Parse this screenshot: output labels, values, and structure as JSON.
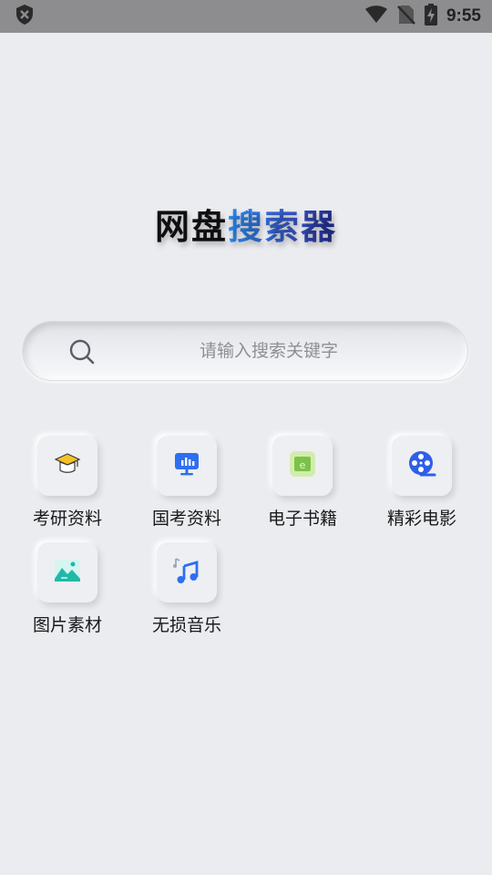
{
  "status_bar": {
    "time": "9:55",
    "icons": [
      "shield-icon",
      "wifi-icon",
      "no-sim-icon",
      "battery-charging-icon"
    ]
  },
  "app": {
    "title_part1": "网盘",
    "title_part2": "搜索器"
  },
  "search": {
    "placeholder": "请输入搜索关键字",
    "value": ""
  },
  "categories": [
    {
      "label": "考研资料",
      "icon": "graduation-cap-icon"
    },
    {
      "label": "国考资料",
      "icon": "presentation-board-icon"
    },
    {
      "label": "电子书籍",
      "icon": "ebook-icon"
    },
    {
      "label": "精彩电影",
      "icon": "film-reel-icon"
    },
    {
      "label": "图片素材",
      "icon": "image-icon"
    },
    {
      "label": "无损音乐",
      "icon": "music-note-icon"
    }
  ],
  "colors": {
    "background": "#ebecf0",
    "status_bar": "#8d8d8f",
    "title_blue": "#2a8ef2",
    "title_navy": "#1e2a8a",
    "accent_blue": "#2f6ef0"
  }
}
